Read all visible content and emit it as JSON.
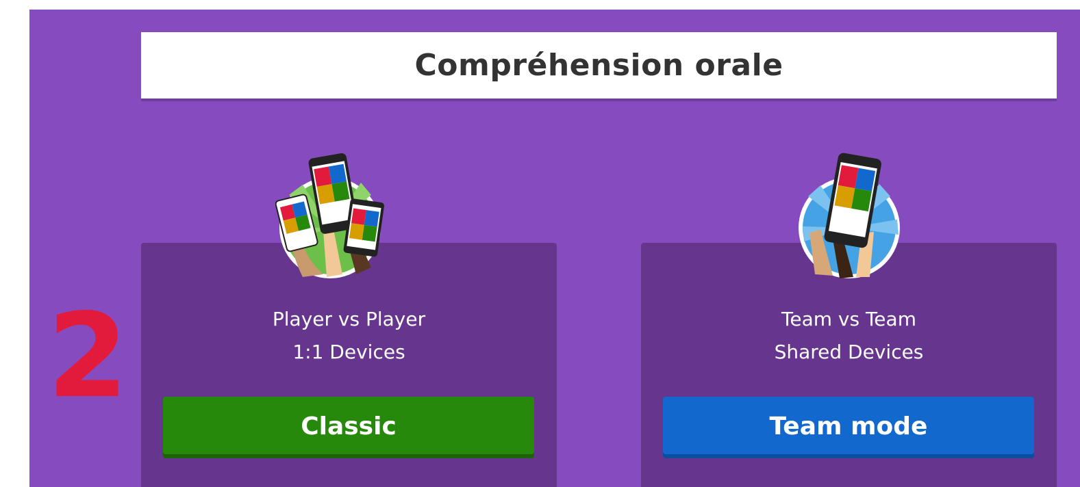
{
  "header": {
    "title": "Compréhension orale"
  },
  "step_marker": {
    "number": "2"
  },
  "modes": [
    {
      "icon": "players-with-phones-icon",
      "line1": "Player vs Player",
      "line2": "1:1 Devices",
      "button_label": "Classic",
      "button_color": "#26890c"
    },
    {
      "icon": "team-shared-phone-icon",
      "line1": "Team vs Team",
      "line2": "Shared Devices",
      "button_label": "Team mode",
      "button_color": "#1368ce"
    }
  ],
  "colors": {
    "background": "#864cbf",
    "card": "#66368e",
    "answer_red": "#e21b3c",
    "answer_blue": "#1368ce",
    "answer_yellow": "#d89e00",
    "answer_green": "#26890c"
  }
}
